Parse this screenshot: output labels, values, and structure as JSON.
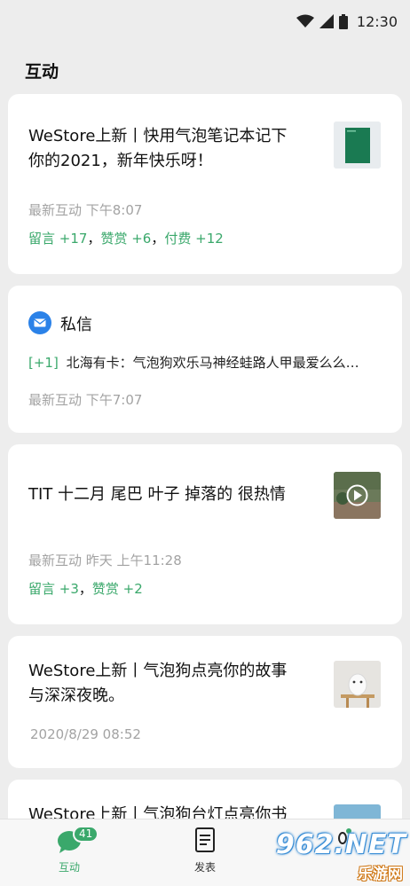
{
  "status_bar": {
    "time": "12:30"
  },
  "page_title": "互动",
  "cards": [
    {
      "title_line1": "WeStore上新丨快用气泡笔记本记下",
      "title_line2": "你的2021，新年快乐呀！",
      "meta": "最新互动  下午8:07",
      "stat_comments": "留言 +17",
      "stat_rewards": "赞赏 +6",
      "stat_paid": "付费 +12",
      "thumb": "green-notebook-thumbnail"
    },
    {
      "header": "私信",
      "message_badge": "[+1]",
      "message_preview": "北海有卡：气泡狗欢乐马神经蛙路人甲最爱么么…",
      "meta": "最新互动   下午7:07"
    },
    {
      "title": "TIT 十二月 尾巴 叶子 掉落的 很热情",
      "meta": "最新互动 昨天 上午11:28",
      "stat_comments": "留言 +3",
      "stat_rewards": "赞赏 +2",
      "thumb": "video-thumbnail"
    },
    {
      "title_line1": "WeStore上新丨气泡狗点亮你的故事",
      "title_line2": "与深深夜晚。",
      "meta": "2020/8/29  08:52",
      "thumb": "white-dog-lamp-thumbnail"
    },
    {
      "title_line1": "WeStore上新丨气泡狗台灯点亮你书"
    }
  ],
  "tabbar": {
    "tabs": [
      {
        "label": "互动",
        "badge": "41"
      },
      {
        "label": "发表"
      },
      {
        "label": ""
      }
    ]
  },
  "watermark": {
    "brand": "962.NET",
    "subtitle": "乐游网"
  },
  "colors": {
    "accent": "#3aa86b",
    "mail_blue": "#2b82e8"
  },
  "separator": "，"
}
